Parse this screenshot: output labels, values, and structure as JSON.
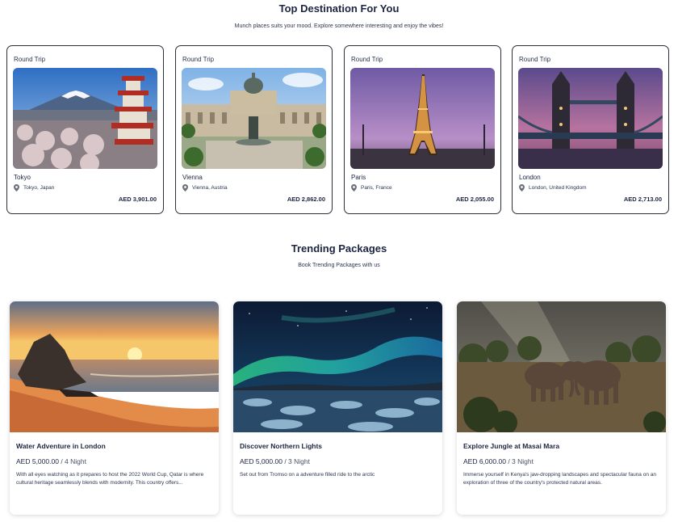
{
  "destinations": {
    "title": "Top Destination For You",
    "subtitle": "Munch places suits your mood. Explore somewhere interesting and enjoy the vibes!",
    "cards": [
      {
        "trip": "Round Trip",
        "city": "Tokyo",
        "location": "Tokyo, Japan",
        "price": "AED 3,901.00",
        "image": "mount-fuji-pagoda"
      },
      {
        "trip": "Round Trip",
        "city": "Vienna",
        "location": "Vienna, Austria",
        "price": "AED 2,862.00",
        "image": "vienna-museum"
      },
      {
        "trip": "Round Trip",
        "city": "Paris",
        "location": "Paris, France",
        "price": "AED 2,055.00",
        "image": "eiffel-tower"
      },
      {
        "trip": "Round Trip",
        "city": "London",
        "location": "London, United Kingdom",
        "price": "AED 2,713.00",
        "image": "tower-bridge"
      }
    ],
    "location_icon": "map-pin-icon"
  },
  "packages": {
    "title": "Trending Packages",
    "subtitle": "Book Trending Packages with us",
    "cards": [
      {
        "name": "Water Adventure in London",
        "price": "AED 5,000.00",
        "nights": "/ 4 Night",
        "description": "With all eyes watching as it prepares to host the 2022 World Cup, Qatar is where cultural heritage seamlessly blends with modernity. This country offers...",
        "image": "beach-sunset"
      },
      {
        "name": "Discover Northern Lights",
        "price": "AED 5,000.00",
        "nights": "/ 3 Night",
        "description": "Set out from Tromso on a adventure filled ride to the arctic",
        "image": "aurora"
      },
      {
        "name": "Explore Jungle at Masai Mara",
        "price": "AED 6,000.00",
        "nights": "/ 3 Night",
        "description": "Immerse yourself in Kenya's jaw-dropping landscapes and spectacular fauna on an exploration of three of the country's protected natural areas.",
        "image": "elephants"
      }
    ]
  }
}
